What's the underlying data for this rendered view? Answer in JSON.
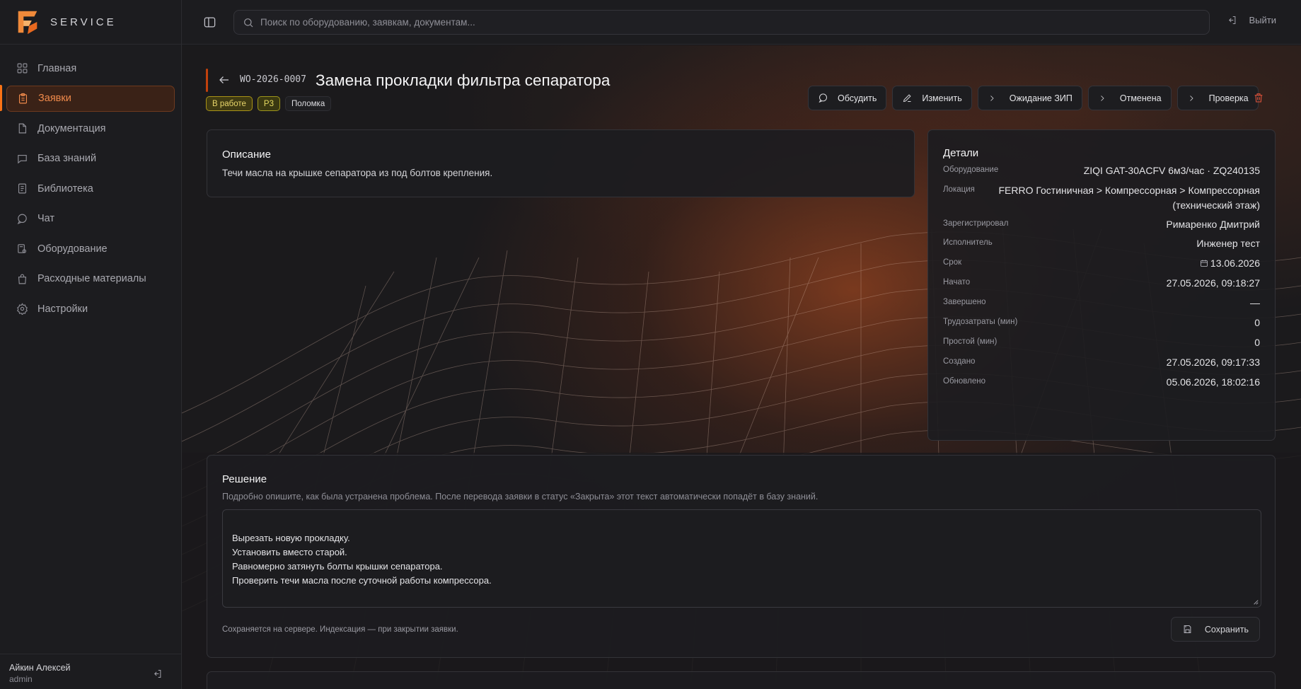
{
  "brand": {
    "name": "SERVICE"
  },
  "sidebar": {
    "items": [
      {
        "label": "Главная",
        "icon": "dashboard-icon"
      },
      {
        "label": "Заявки",
        "icon": "clipboard-icon",
        "active": true
      },
      {
        "label": "Документация",
        "icon": "document-icon"
      },
      {
        "label": "База знаний",
        "icon": "chat-bubble-icon"
      },
      {
        "label": "Библиотека",
        "icon": "book-icon"
      },
      {
        "label": "Чат",
        "icon": "message-icon"
      },
      {
        "label": "Оборудование",
        "icon": "equipment-icon"
      },
      {
        "label": "Расходные материалы",
        "icon": "bag-icon"
      },
      {
        "label": "Настройки",
        "icon": "gear-icon"
      }
    ],
    "user": {
      "name": "Айкин Алексей",
      "role": "admin"
    }
  },
  "topbar": {
    "search_placeholder": "Поиск по оборудованию, заявкам, документам...",
    "logout_label": "Выйти"
  },
  "workorder": {
    "id": "WO-2026-0007",
    "title": "Замена прокладки фильтра сепаратора",
    "badges": {
      "status": "В работе",
      "priority": "P3",
      "type": "Поломка"
    },
    "actions": {
      "discuss": "Обсудить",
      "edit": "Изменить",
      "wait_parts": "Ожидание ЗИП",
      "cancelled": "Отменена",
      "review": "Проверка"
    }
  },
  "description": {
    "title": "Описание",
    "text": "Течи масла на крышке сепаратора из под болтов крепления."
  },
  "details": {
    "title": "Детали",
    "rows": [
      {
        "label": "Оборудование",
        "value": "ZIQI GAT-30ACFV 6м3/час · ZQ240135"
      },
      {
        "label": "Локация",
        "value": "FERRO Гостиничная > Компрессорная > Компрессорная (технический этаж)"
      },
      {
        "label": "Зарегистрировал",
        "value": "Римаренко Дмитрий"
      },
      {
        "label": "Исполнитель",
        "value": "Инженер тест"
      },
      {
        "label": "Срок",
        "value": "13.06.2026"
      },
      {
        "label": "Начато",
        "value": "27.05.2026, 09:18:27"
      },
      {
        "label": "Завершено",
        "value": "—"
      },
      {
        "label": "Трудозатраты (мин)",
        "value": "0"
      },
      {
        "label": "Простой (мин)",
        "value": "0"
      },
      {
        "label": "Создано",
        "value": "27.05.2026, 09:17:33"
      },
      {
        "label": "Обновлено",
        "value": "05.06.2026, 18:02:16"
      }
    ]
  },
  "solution": {
    "title": "Решение",
    "hint": "Подробно опишите, как была устранена проблема. После перевода заявки в статус «Закрыта» этот текст автоматически попадёт в базу знаний.",
    "text": "Вырезать новую прокладку.\nУстановить вместо старой.\nРавномерно затянуть болты крышки сепаратора.\nПроверить течи масла после суточной работы компрессора.",
    "note": "Сохраняется на сервере. Индексация — при закрытии заявки.",
    "save_label": "Сохранить"
  },
  "colors": {
    "accent": "#f97316",
    "background": "#18181b",
    "danger": "#e0533b"
  }
}
